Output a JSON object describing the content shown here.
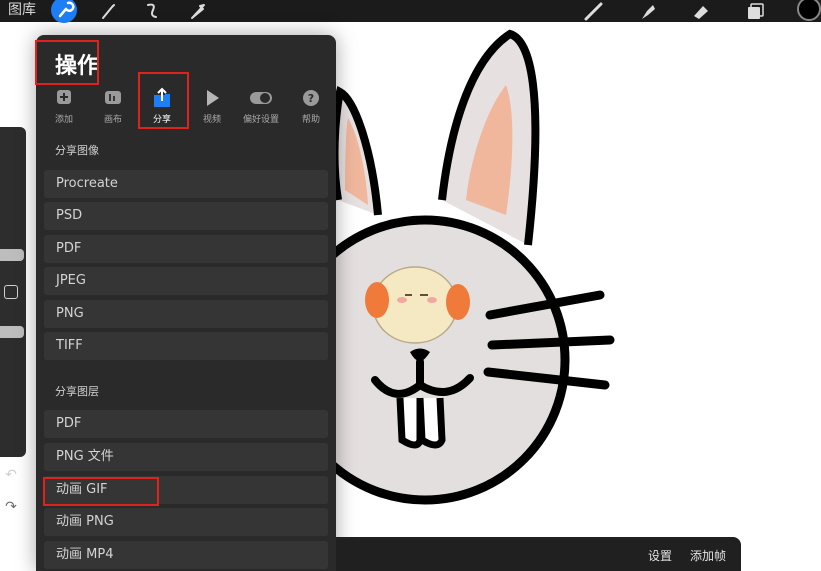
{
  "topbar": {
    "gallery_label": "图库",
    "tools": [
      "actions-icon",
      "adjustments-icon",
      "selection-icon",
      "transform-icon",
      "brush-icon",
      "smudge-icon",
      "eraser-icon",
      "layers-icon"
    ],
    "color_swatch": "#000000"
  },
  "panel": {
    "title": "操作",
    "tabs": [
      {
        "label": "添加",
        "icon": "add-icon"
      },
      {
        "label": "画布",
        "icon": "canvas-icon"
      },
      {
        "label": "分享",
        "icon": "share-icon",
        "active": true
      },
      {
        "label": "视频",
        "icon": "video-icon"
      },
      {
        "label": "偏好设置",
        "icon": "preferences-icon"
      },
      {
        "label": "帮助",
        "icon": "help-icon"
      }
    ],
    "share_image": {
      "title": "分享图像",
      "items": [
        "Procreate",
        "PSD",
        "PDF",
        "JPEG",
        "PNG",
        "TIFF"
      ]
    },
    "share_layers": {
      "title": "分享图层",
      "items": [
        "PDF",
        "PNG 文件",
        "动画 GIF",
        "动画 PNG",
        "动画 MP4"
      ]
    }
  },
  "timeline": {
    "settings_label": "设置",
    "add_frame_label": "添加帧"
  },
  "colors": {
    "accent": "#1d7ef5",
    "highlight": "#e0221c",
    "panel_bg": "#2a2a2a"
  }
}
